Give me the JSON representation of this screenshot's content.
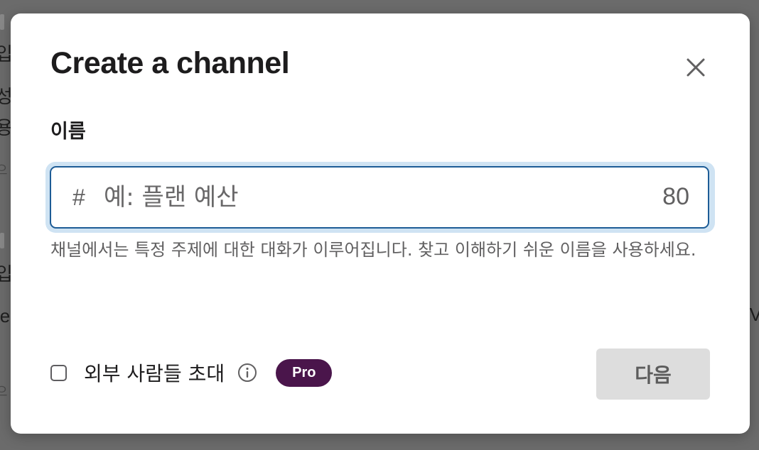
{
  "modal": {
    "title": "Create a channel",
    "close_icon": "close-icon",
    "name_field": {
      "label": "이름",
      "prefix": "#",
      "placeholder": "예: 플랜 예산",
      "value": "",
      "char_remaining": "80"
    },
    "help_text": "채널에서는 특정 주제에 대한 대화가 이루어집니다. 찾고 이해하기 쉬운 이름을 사용하세요.",
    "invite_external": {
      "label": "외부 사람들 초대",
      "checked": false,
      "info_icon": "info-icon",
      "badge": "Pro"
    },
    "next_button": "다음"
  },
  "colors": {
    "brand_purple": "#4a154b",
    "focus_border": "#1d5c96",
    "focus_ring": "#cfe3f3",
    "disabled_button_bg": "#dddddd"
  }
}
